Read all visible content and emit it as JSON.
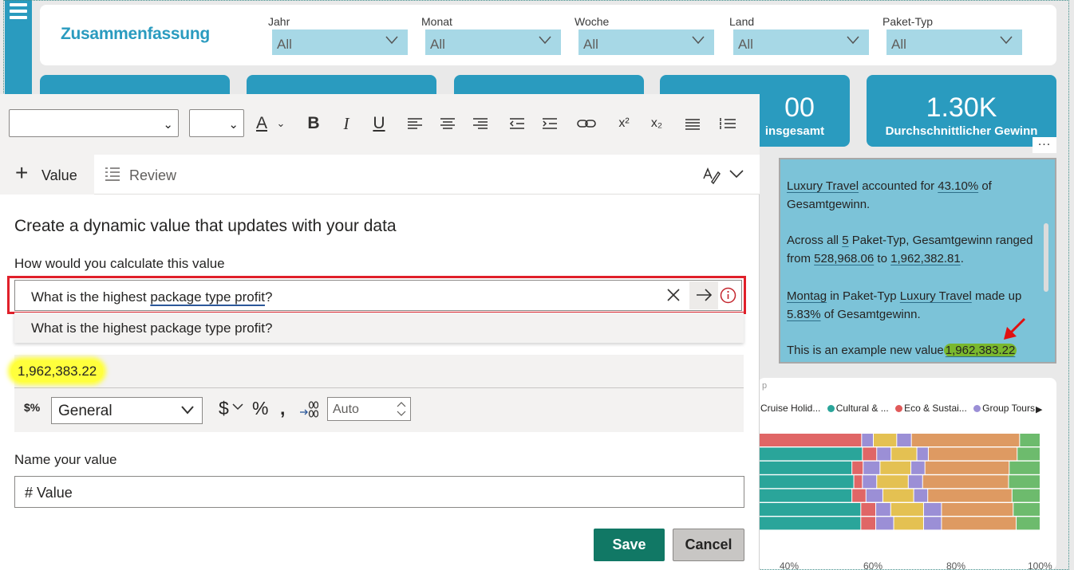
{
  "report": {
    "title": "Zusammenfassung",
    "slicers": [
      {
        "label": "Jahr",
        "value": "All"
      },
      {
        "label": "Monat",
        "value": "All"
      },
      {
        "label": "Woche",
        "value": "All"
      },
      {
        "label": "Land",
        "value": "All"
      },
      {
        "label": "Paket-Typ",
        "value": "All"
      }
    ],
    "kpis": [
      {
        "value": "00",
        "label": "insgesamt"
      },
      {
        "value": "1.30K",
        "label": "Durchschnittlicher Gewinn"
      }
    ],
    "smart_narrative": {
      "p1_a": "Luxury Travel",
      "p1_b": " accounted for ",
      "p1_c": "43.10%",
      "p1_d": " of Gesamtgewinn.",
      "p2_a": "Across all ",
      "p2_b": "5",
      "p2_c": " Paket-Typ, Gesamtgewinn ranged from ",
      "p2_d": "528,968.06",
      "p2_e": " to ",
      "p2_f": "1,962,382.81",
      "p2_g": ".",
      "p3_a": "Montag",
      "p3_b": " in Paket-Typ ",
      "p3_c": "Luxury Travel",
      "p3_d": " made up ",
      "p3_e": "5.83%",
      "p3_f": " of Gesamtgewinn.",
      "p4_a": "This is an example new value",
      "p4_b": "1,962,383.22",
      "more": "..."
    },
    "chart": {
      "partial_title": "p",
      "legend": [
        {
          "name": "Cruise Holid...",
          "color": "#e06666"
        },
        {
          "name": "Cultural & ...",
          "color": "#2aa59a"
        },
        {
          "name": "Eco & Sustai...",
          "color": "#e05a5a"
        },
        {
          "name": "Group Tours",
          "color": "#9b8fd6"
        }
      ],
      "x_ticks": [
        "40%",
        "60%",
        "80%",
        "100%"
      ]
    }
  },
  "chart_data": {
    "type": "bar",
    "stacked": "100%",
    "orientation": "horizontal",
    "x_ticks": [
      "40%",
      "60%",
      "80%",
      "100%"
    ],
    "segment_colors": [
      "#e06666",
      "#9b8fd6",
      "#e4c152",
      "#9b8fd6",
      "#de9a62",
      "#6dbb6d"
    ],
    "rows": [
      [
        35,
        4,
        8,
        5,
        37,
        7
      ],
      [
        36,
        5,
        5,
        9,
        4,
        31,
        8
      ],
      [
        33,
        4,
        6,
        11,
        5,
        30,
        11
      ],
      [
        33,
        3,
        5,
        11,
        5,
        30,
        11
      ],
      [
        33,
        5,
        6,
        11,
        5,
        30,
        10
      ],
      [
        34,
        5,
        5,
        11,
        6,
        24,
        9
      ],
      [
        34,
        5,
        6,
        10,
        6,
        25,
        8
      ]
    ]
  },
  "toolbar": {
    "font_family": "",
    "font_size": "",
    "buttons": [
      "A",
      "B",
      "I",
      "U"
    ]
  },
  "tabs": {
    "value": "Value",
    "review": "Review"
  },
  "editor": {
    "title": "Create a dynamic value that updates with your data",
    "calc_label": "How would you calculate this value",
    "query_before": "What is the highest ",
    "query_underlined": "package type profit",
    "query_after": "?",
    "suggestion": "What is the highest package type profit?",
    "result": "1,962,383.22",
    "format": "General",
    "currency": "$",
    "percent": "%",
    "comma": ",",
    "decimals": "Auto",
    "name_label": "Name your value",
    "name_value": "# Value",
    "save": "Save",
    "cancel": "Cancel"
  }
}
